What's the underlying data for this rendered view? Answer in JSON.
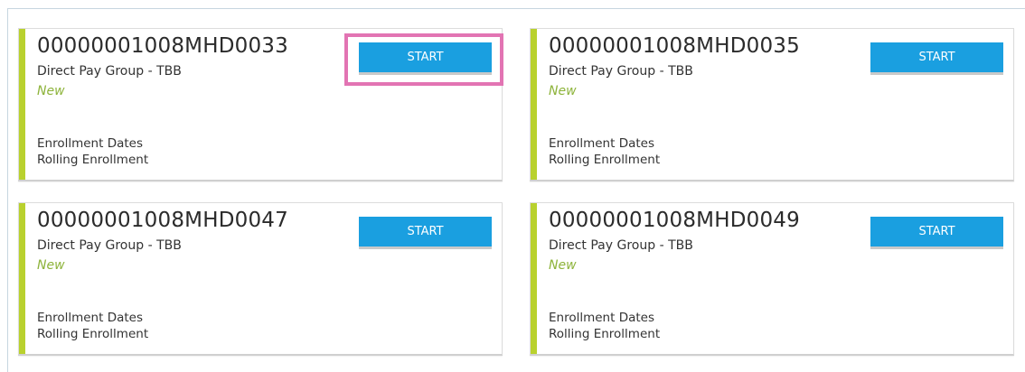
{
  "cards": [
    {
      "code": "00000001008MHD0033",
      "group": "Direct Pay Group - TBB",
      "status": "New",
      "enrollment_label": "Enrollment Dates",
      "enrollment_value": "Rolling Enrollment",
      "button_label": "START"
    },
    {
      "code": "00000001008MHD0035",
      "group": "Direct Pay Group - TBB",
      "status": "New",
      "enrollment_label": "Enrollment Dates",
      "enrollment_value": "Rolling Enrollment",
      "button_label": "START"
    },
    {
      "code": "00000001008MHD0047",
      "group": "Direct Pay Group - TBB",
      "status": "New",
      "enrollment_label": "Enrollment Dates",
      "enrollment_value": "Rolling Enrollment",
      "button_label": "START"
    },
    {
      "code": "00000001008MHD0049",
      "group": "Direct Pay Group - TBB",
      "status": "New",
      "enrollment_label": "Enrollment Dates",
      "enrollment_value": "Rolling Enrollment",
      "button_label": "START"
    }
  ],
  "colors": {
    "accent_bar": "#b9d12e",
    "button": "#1a9fe0",
    "status_text": "#8db33a",
    "highlight": "#e274b3"
  }
}
